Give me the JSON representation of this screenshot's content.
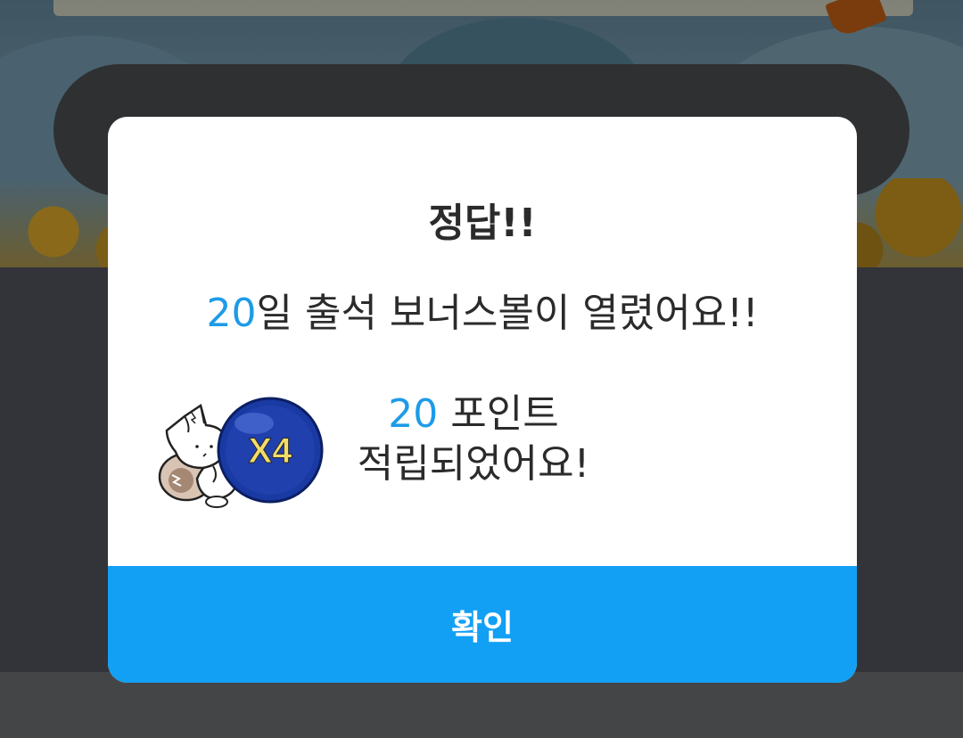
{
  "dialog": {
    "title": "정답!!",
    "message": {
      "highlight": "20",
      "text": "일 출석 보너스볼이 열렸어요!!"
    },
    "reward": {
      "badge": "X4",
      "points_value": "20",
      "points_label": " 포인트",
      "status_text": "적립되었어요!"
    },
    "confirm_label": "확인"
  },
  "colors": {
    "accent": "#1d9be8",
    "button": "#12a0f5",
    "ball": "#1a3aa3",
    "badge_text": "#f4dc6a"
  },
  "icons": {
    "mascot": "fox-mascot-icon",
    "ball": "bonus-ball-icon"
  }
}
